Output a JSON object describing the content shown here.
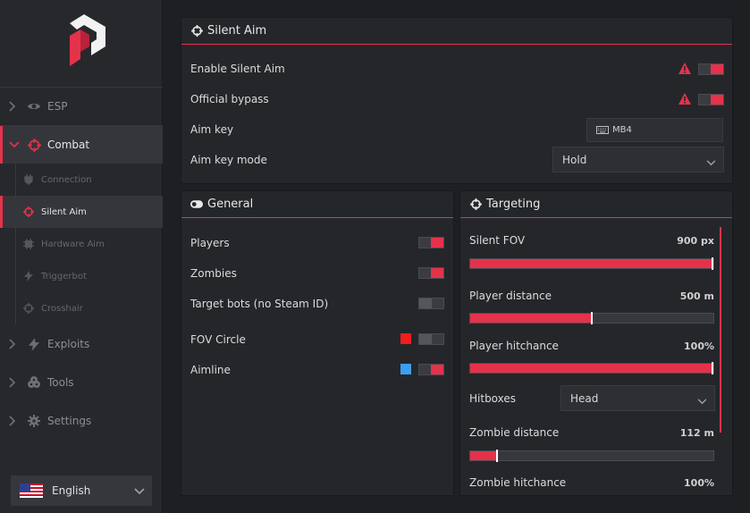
{
  "sidebar": {
    "nav": [
      {
        "label": "ESP",
        "icon": "eye-icon"
      },
      {
        "label": "Combat",
        "icon": "crosshair-icon"
      },
      {
        "label": "Exploits",
        "icon": "bolt-icon"
      },
      {
        "label": "Tools",
        "icon": "cogs-icon"
      },
      {
        "label": "Settings",
        "icon": "gear-icon"
      }
    ],
    "sub": [
      {
        "label": "Connection",
        "icon": "plug-icon"
      },
      {
        "label": "Silent Aim",
        "icon": "crosshair-icon"
      },
      {
        "label": "Hardware Aim",
        "icon": "chip-icon"
      },
      {
        "label": "Triggerbot",
        "icon": "bolt-icon"
      },
      {
        "label": "Crosshair",
        "icon": "crosshair-icon"
      }
    ],
    "language": "English"
  },
  "silent_aim": {
    "title": "Silent Aim",
    "enable_label": "Enable Silent Aim",
    "enable_on": true,
    "bypass_label": "Official bypass",
    "bypass_on": true,
    "aim_key_label": "Aim key",
    "aim_key_value": "MB4",
    "aim_key_mode_label": "Aim key mode",
    "aim_key_mode_value": "Hold"
  },
  "general": {
    "title": "General",
    "players_label": "Players",
    "zombies_label": "Zombies",
    "bots_label": "Target bots (no Steam ID)",
    "fov_label": "FOV Circle",
    "aimline_label": "Aimline"
  },
  "targeting": {
    "title": "Targeting",
    "silent_fov_label": "Silent FOV",
    "silent_fov_value": "900 px",
    "silent_fov_fraction": 1.0,
    "player_distance_label": "Player distance",
    "player_distance_value": "500 m",
    "player_distance_fraction": 0.5,
    "player_hitchance_label": "Player hitchance",
    "player_hitchance_value": "100%",
    "player_hitchance_fraction": 1.0,
    "hitboxes_label": "Hitboxes",
    "hitboxes_value": "Head",
    "zombie_distance_label": "Zombie distance",
    "zombie_distance_value": "112 m",
    "zombie_distance_fraction": 0.11,
    "zombie_hitchance_label": "Zombie hitchance",
    "zombie_hitchance_value": "100%"
  },
  "colors": {
    "accent": "#e5324b",
    "fov_swatch": "#f21d1d",
    "aimline_swatch": "#3d9df0"
  }
}
